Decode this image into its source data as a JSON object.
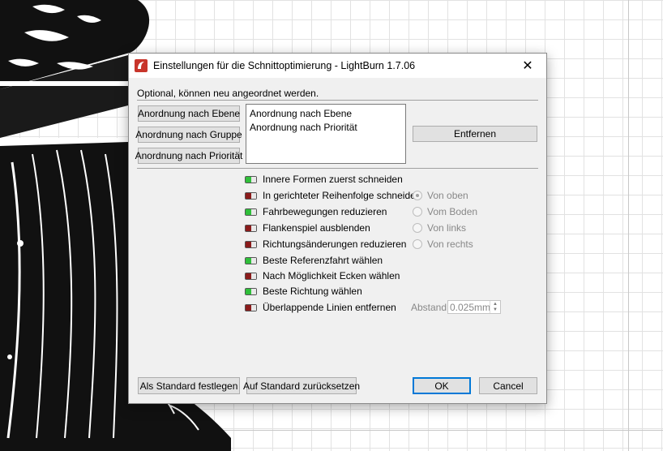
{
  "window": {
    "title": "Einstellungen für die Schnittoptimierung - LightBurn 1.7.06",
    "close_glyph": "✕"
  },
  "subtitle": "Optional, können neu angeordnet werden.",
  "order_buttons": [
    "Anordnung nach Ebene",
    "Anordnung nach Gruppe",
    "Anordnung nach Priorität"
  ],
  "order_list": [
    "Anordnung nach Ebene",
    "Anordnung nach Priorität"
  ],
  "remove_button": "Entfernen",
  "options": [
    {
      "label": "Innere Formen zuerst schneiden",
      "enabled": true
    },
    {
      "label": "In gerichteter Reihenfolge schneiden",
      "enabled": false
    },
    {
      "label": "Fahrbewegungen reduzieren",
      "enabled": true
    },
    {
      "label": "Flankenspiel ausblenden",
      "enabled": false
    },
    {
      "label": "Richtungsänderungen reduzieren",
      "enabled": false
    },
    {
      "label": "Beste Referenzfahrt wählen",
      "enabled": true
    },
    {
      "label": "Nach Möglichkeit Ecken wählen",
      "enabled": false
    },
    {
      "label": "Beste Richtung wählen",
      "enabled": true
    },
    {
      "label": "Überlappende Linien entfernen",
      "enabled": false
    }
  ],
  "direction_options": [
    {
      "label": "Von oben",
      "selected": true
    },
    {
      "label": "Vom Boden",
      "selected": false
    },
    {
      "label": "Von links",
      "selected": false
    },
    {
      "label": "Von rechts",
      "selected": false
    }
  ],
  "distance": {
    "label": "Abstand:",
    "value": "0.025mm"
  },
  "footer": {
    "set_default": "Als Standard festlegen",
    "reset_default": "Auf Standard zurücksetzen",
    "ok": "OK",
    "cancel": "Cancel"
  },
  "colors": {
    "toggle_on": "#2fbf3a",
    "toggle_off": "#8b1b1b",
    "accent": "#0078d7",
    "app_icon": "#c8352b"
  }
}
